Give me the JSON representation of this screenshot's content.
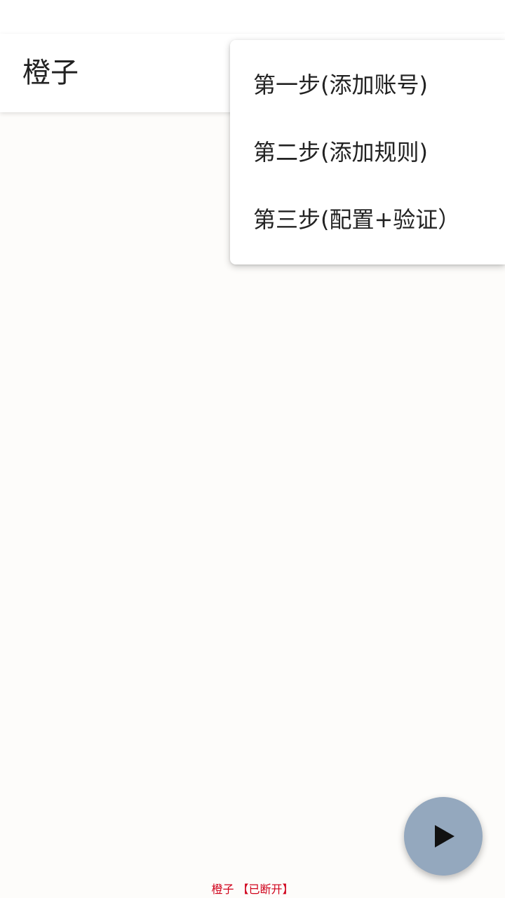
{
  "app_bar": {
    "title": "橙子"
  },
  "overflow_menu": {
    "items": [
      {
        "label": "第一步(添加账号)"
      },
      {
        "label": "第二步(添加规则)"
      },
      {
        "label": "第三步(配置+验证）"
      }
    ]
  },
  "fab": {
    "icon": "play-icon",
    "background": "#94a8be"
  },
  "footer": {
    "status_text": "橙子 【已断开】",
    "color": "#d0021b"
  }
}
